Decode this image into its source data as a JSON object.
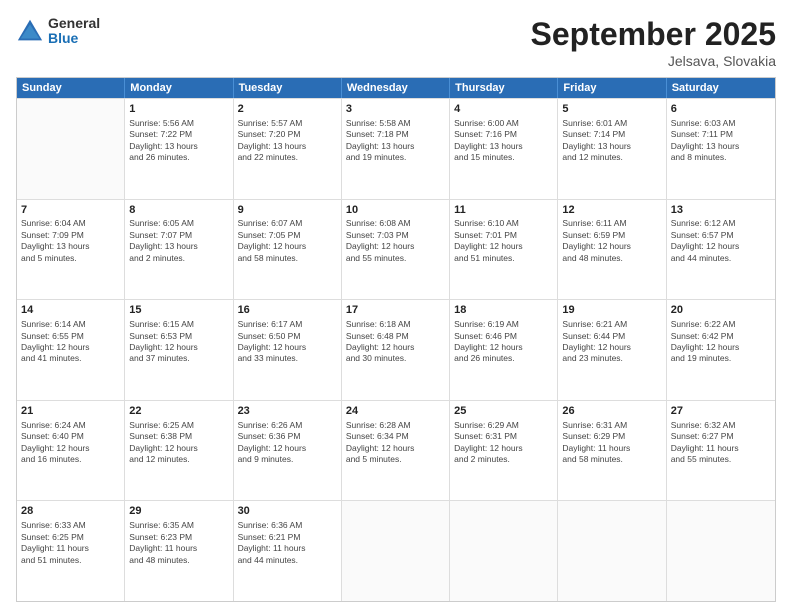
{
  "header": {
    "logo_general": "General",
    "logo_blue": "Blue",
    "month": "September 2025",
    "location": "Jelsava, Slovakia"
  },
  "days_of_week": [
    "Sunday",
    "Monday",
    "Tuesday",
    "Wednesday",
    "Thursday",
    "Friday",
    "Saturday"
  ],
  "weeks": [
    [
      {
        "day": "",
        "info": ""
      },
      {
        "day": "1",
        "info": "Sunrise: 5:56 AM\nSunset: 7:22 PM\nDaylight: 13 hours\nand 26 minutes."
      },
      {
        "day": "2",
        "info": "Sunrise: 5:57 AM\nSunset: 7:20 PM\nDaylight: 13 hours\nand 22 minutes."
      },
      {
        "day": "3",
        "info": "Sunrise: 5:58 AM\nSunset: 7:18 PM\nDaylight: 13 hours\nand 19 minutes."
      },
      {
        "day": "4",
        "info": "Sunrise: 6:00 AM\nSunset: 7:16 PM\nDaylight: 13 hours\nand 15 minutes."
      },
      {
        "day": "5",
        "info": "Sunrise: 6:01 AM\nSunset: 7:14 PM\nDaylight: 13 hours\nand 12 minutes."
      },
      {
        "day": "6",
        "info": "Sunrise: 6:03 AM\nSunset: 7:11 PM\nDaylight: 13 hours\nand 8 minutes."
      }
    ],
    [
      {
        "day": "7",
        "info": "Sunrise: 6:04 AM\nSunset: 7:09 PM\nDaylight: 13 hours\nand 5 minutes."
      },
      {
        "day": "8",
        "info": "Sunrise: 6:05 AM\nSunset: 7:07 PM\nDaylight: 13 hours\nand 2 minutes."
      },
      {
        "day": "9",
        "info": "Sunrise: 6:07 AM\nSunset: 7:05 PM\nDaylight: 12 hours\nand 58 minutes."
      },
      {
        "day": "10",
        "info": "Sunrise: 6:08 AM\nSunset: 7:03 PM\nDaylight: 12 hours\nand 55 minutes."
      },
      {
        "day": "11",
        "info": "Sunrise: 6:10 AM\nSunset: 7:01 PM\nDaylight: 12 hours\nand 51 minutes."
      },
      {
        "day": "12",
        "info": "Sunrise: 6:11 AM\nSunset: 6:59 PM\nDaylight: 12 hours\nand 48 minutes."
      },
      {
        "day": "13",
        "info": "Sunrise: 6:12 AM\nSunset: 6:57 PM\nDaylight: 12 hours\nand 44 minutes."
      }
    ],
    [
      {
        "day": "14",
        "info": "Sunrise: 6:14 AM\nSunset: 6:55 PM\nDaylight: 12 hours\nand 41 minutes."
      },
      {
        "day": "15",
        "info": "Sunrise: 6:15 AM\nSunset: 6:53 PM\nDaylight: 12 hours\nand 37 minutes."
      },
      {
        "day": "16",
        "info": "Sunrise: 6:17 AM\nSunset: 6:50 PM\nDaylight: 12 hours\nand 33 minutes."
      },
      {
        "day": "17",
        "info": "Sunrise: 6:18 AM\nSunset: 6:48 PM\nDaylight: 12 hours\nand 30 minutes."
      },
      {
        "day": "18",
        "info": "Sunrise: 6:19 AM\nSunset: 6:46 PM\nDaylight: 12 hours\nand 26 minutes."
      },
      {
        "day": "19",
        "info": "Sunrise: 6:21 AM\nSunset: 6:44 PM\nDaylight: 12 hours\nand 23 minutes."
      },
      {
        "day": "20",
        "info": "Sunrise: 6:22 AM\nSunset: 6:42 PM\nDaylight: 12 hours\nand 19 minutes."
      }
    ],
    [
      {
        "day": "21",
        "info": "Sunrise: 6:24 AM\nSunset: 6:40 PM\nDaylight: 12 hours\nand 16 minutes."
      },
      {
        "day": "22",
        "info": "Sunrise: 6:25 AM\nSunset: 6:38 PM\nDaylight: 12 hours\nand 12 minutes."
      },
      {
        "day": "23",
        "info": "Sunrise: 6:26 AM\nSunset: 6:36 PM\nDaylight: 12 hours\nand 9 minutes."
      },
      {
        "day": "24",
        "info": "Sunrise: 6:28 AM\nSunset: 6:34 PM\nDaylight: 12 hours\nand 5 minutes."
      },
      {
        "day": "25",
        "info": "Sunrise: 6:29 AM\nSunset: 6:31 PM\nDaylight: 12 hours\nand 2 minutes."
      },
      {
        "day": "26",
        "info": "Sunrise: 6:31 AM\nSunset: 6:29 PM\nDaylight: 11 hours\nand 58 minutes."
      },
      {
        "day": "27",
        "info": "Sunrise: 6:32 AM\nSunset: 6:27 PM\nDaylight: 11 hours\nand 55 minutes."
      }
    ],
    [
      {
        "day": "28",
        "info": "Sunrise: 6:33 AM\nSunset: 6:25 PM\nDaylight: 11 hours\nand 51 minutes."
      },
      {
        "day": "29",
        "info": "Sunrise: 6:35 AM\nSunset: 6:23 PM\nDaylight: 11 hours\nand 48 minutes."
      },
      {
        "day": "30",
        "info": "Sunrise: 6:36 AM\nSunset: 6:21 PM\nDaylight: 11 hours\nand 44 minutes."
      },
      {
        "day": "",
        "info": ""
      },
      {
        "day": "",
        "info": ""
      },
      {
        "day": "",
        "info": ""
      },
      {
        "day": "",
        "info": ""
      }
    ]
  ]
}
